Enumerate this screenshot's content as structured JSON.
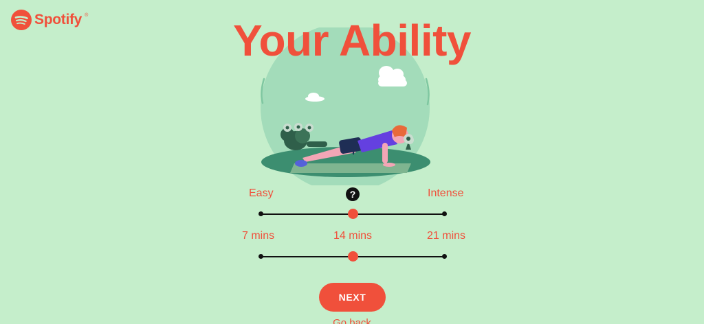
{
  "logo": {
    "wordmark": "Spotify",
    "trademark": "®",
    "icon": "spotify-logo-icon",
    "color": "#f0503b"
  },
  "title": "Your Ability",
  "help_icon": {
    "icon": "question-mark-icon",
    "glyph": "?"
  },
  "intensity_slider": {
    "min_label": "Easy",
    "max_label": "Intense",
    "value_fraction": 0.5
  },
  "duration_slider": {
    "labels": [
      "7 mins",
      "14 mins",
      "21 mins"
    ],
    "selected": "14 mins",
    "value_fraction": 0.5
  },
  "next_button": {
    "label": "NEXT"
  },
  "go_back": {
    "label": "Go back"
  },
  "colors": {
    "background": "#c5eecb",
    "accent": "#f0503b",
    "track": "#111111"
  }
}
